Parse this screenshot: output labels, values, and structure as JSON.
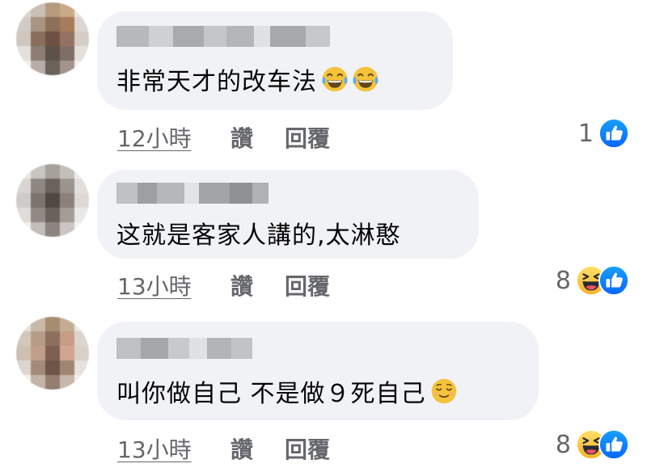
{
  "comments": [
    {
      "text": "非常天才的改车法",
      "emojis": [
        "joy-emoji",
        "joy-emoji"
      ],
      "time": "12小時",
      "like_label": "讚",
      "reply_label": "回覆",
      "reaction_count": "1",
      "reactions": [
        "like-icon"
      ]
    },
    {
      "text": "这就是客家人講的,太淋憨",
      "emojis": [],
      "time": "13小時",
      "like_label": "讚",
      "reply_label": "回覆",
      "reaction_count": "8",
      "reactions": [
        "haha-icon",
        "like-icon"
      ]
    },
    {
      "text": "叫你做自己 不是做９死自己",
      "emojis": [
        "relieved-emoji"
      ],
      "time": "13小時",
      "like_label": "讚",
      "reply_label": "回覆",
      "reaction_count": "8",
      "reactions": [
        "haha-icon",
        "like-icon"
      ]
    }
  ],
  "colors": {
    "bubble": "#f0f2f5",
    "meta_text": "#65676b",
    "like_blue": "#1877f2"
  }
}
